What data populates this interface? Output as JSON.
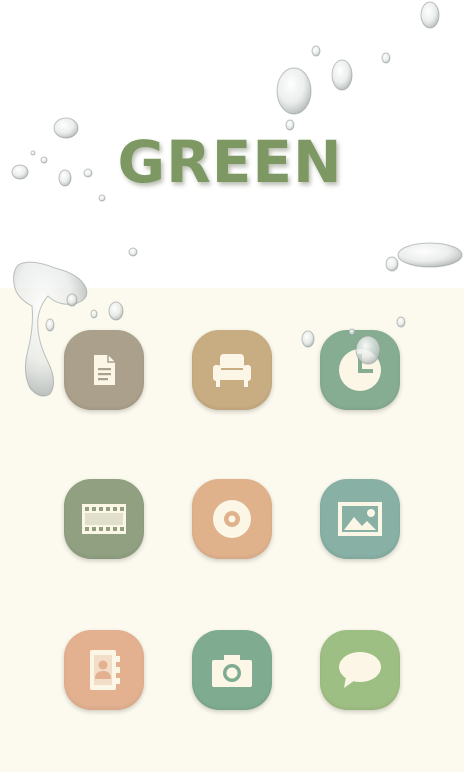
{
  "title": "GREEN",
  "colors": {
    "title": "#7d9862",
    "header_bg": "#ffffff",
    "body_bg": "#fcfaee",
    "glyph": "#fbf6e6"
  },
  "icons": [
    {
      "name": "document-icon",
      "color": "#aaa08c"
    },
    {
      "name": "armchair-icon",
      "color": "#c8ac82"
    },
    {
      "name": "clock-icon",
      "color": "#86ad91"
    },
    {
      "name": "film-icon",
      "color": "#90a081"
    },
    {
      "name": "disc-icon",
      "color": "#e0b28c"
    },
    {
      "name": "picture-icon",
      "color": "#88b0a4"
    },
    {
      "name": "contacts-icon",
      "color": "#e3b190"
    },
    {
      "name": "camera-icon",
      "color": "#7fac90"
    },
    {
      "name": "message-icon",
      "color": "#9ebf84"
    }
  ]
}
